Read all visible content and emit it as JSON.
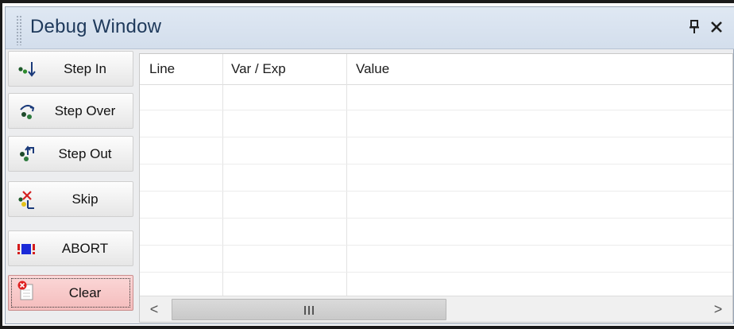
{
  "window": {
    "title": "Debug Window",
    "pin_icon": "pin-icon",
    "close_icon": "close-icon"
  },
  "buttons": [
    {
      "label": "Step In",
      "icon": "step-in-icon"
    },
    {
      "label": "Step Over",
      "icon": "step-over-icon"
    },
    {
      "label": "Step Out",
      "icon": "step-out-icon"
    },
    {
      "label": "Skip",
      "icon": "skip-icon"
    },
    {
      "label": "ABORT",
      "icon": "abort-icon"
    },
    {
      "label": "Clear",
      "icon": "clear-icon",
      "state": "focused"
    }
  ],
  "grid": {
    "columns": [
      "Line",
      "Var / Exp",
      "Value"
    ],
    "rows": []
  },
  "scrollbar": {
    "left_arrow": "<",
    "right_arrow": ">"
  },
  "colors": {
    "title_text": "#1e395b",
    "titlebar": "#d9e3f0",
    "clear_button": "#f6c6c6"
  }
}
